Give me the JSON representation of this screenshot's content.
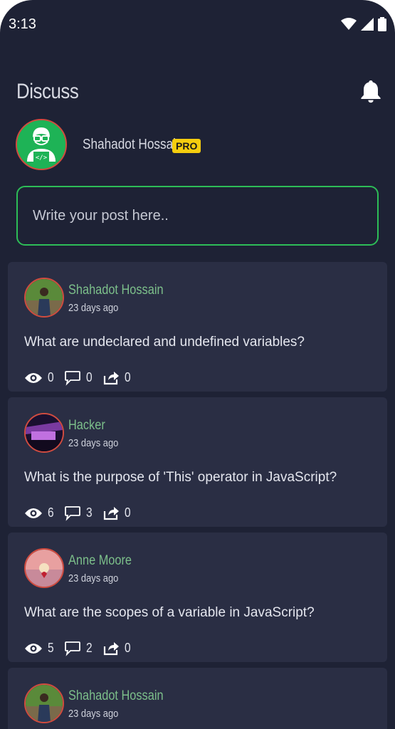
{
  "status_bar": {
    "time": "3:13"
  },
  "header": {
    "title": "Discuss"
  },
  "profile": {
    "name": "Shahadot Hossain",
    "badge": "PRO"
  },
  "composer": {
    "placeholder": "Write your post here.."
  },
  "posts": [
    {
      "author": "Shahadot Hossain",
      "time": "23 days ago",
      "question": "What are undeclared and undefined variables?",
      "views": "0",
      "comments": "0",
      "shares": "0"
    },
    {
      "author": "Hacker",
      "time": "23 days ago",
      "question": "What is the purpose of 'This' operator in JavaScript?",
      "views": "6",
      "comments": "3",
      "shares": "0"
    },
    {
      "author": "Anne Moore",
      "time": "23 days ago",
      "question": "What are the scopes of a variable in JavaScript?",
      "views": "5",
      "comments": "2",
      "shares": "0"
    },
    {
      "author": "Shahadot Hossain",
      "time": "23 days ago"
    }
  ],
  "colors": {
    "background": "#1e2235",
    "card": "#2a2e44",
    "accent_green": "#2dbd57",
    "author_green": "#7cbf8a",
    "pro_yellow": "#f5cd0e",
    "avatar_ring": "#d14b3f"
  }
}
